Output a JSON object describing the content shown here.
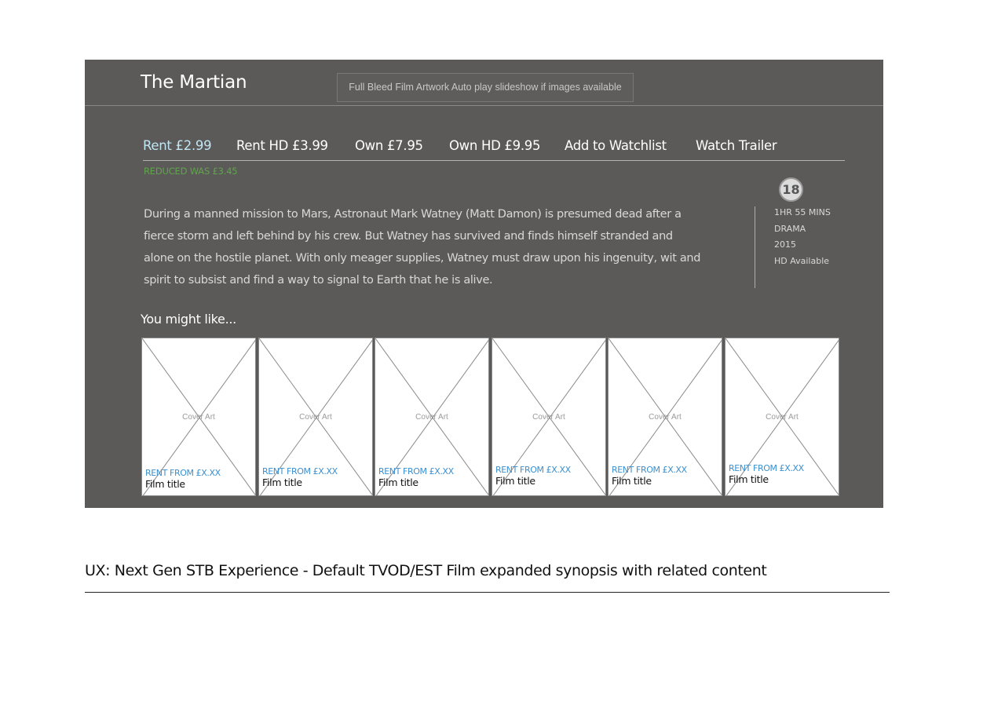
{
  "screen": {
    "film_title": "The Martian",
    "artwork_note": "Full Bleed Film Artwork Auto play slideshow if images available",
    "actions": [
      {
        "label": "Rent £2.99",
        "active": true
      },
      {
        "label": "Rent HD £3.99",
        "active": false
      },
      {
        "label": "Own  £7.95",
        "active": false
      },
      {
        "label": "Own HD £9.95",
        "active": false
      },
      {
        "label": "Add to Watchlist",
        "active": false
      },
      {
        "label": "Watch Trailer",
        "active": false
      }
    ],
    "reduced_note": "REDUCED WAS £3.45",
    "synopsis": [
      "During a manned mission to Mars, Astronaut Mark Watney (Matt Damon) is presumed dead after a",
      "fierce storm and left behind by his crew. But Watney has survived and finds himself stranded and",
      "alone on the hostile planet. With only meager supplies, Watney must draw upon his ingenuity, wit and",
      "spirit to subsist and find a way to signal to Earth that he is alive."
    ],
    "rating": "18",
    "meta": {
      "duration": "1HR  55 MINS",
      "genre": "DRAMA",
      "year": "2015",
      "hd": "HD Available"
    },
    "related_heading": "You might like...",
    "related": [
      {
        "cover_label": "Cover Art",
        "price": "RENT FROM £X.XX",
        "title": "Film title"
      },
      {
        "cover_label": "Cover Art",
        "price": "RENT FROM £X.XX",
        "title": "Film title"
      },
      {
        "cover_label": "Cover Art",
        "price": "RENT FROM £X.XX",
        "title": "Film title"
      },
      {
        "cover_label": "Cover Art",
        "price": "RENT FROM £X.XX",
        "title": "Film title"
      },
      {
        "cover_label": "Cover Art",
        "price": "RENT FROM £X.XX",
        "title": "Film title"
      },
      {
        "cover_label": "Cover Art",
        "price": "RENT FROM £X.XX",
        "title": "Film title"
      }
    ]
  },
  "caption": "UX: Next Gen STB Experience - Default TVOD/EST Film expanded synopsis with related content",
  "colors": {
    "screen_background": "#5c5959",
    "active_action": "#bfe6f2",
    "reduced_note": "#5fa64a",
    "tile_price": "#3a8fd0"
  }
}
